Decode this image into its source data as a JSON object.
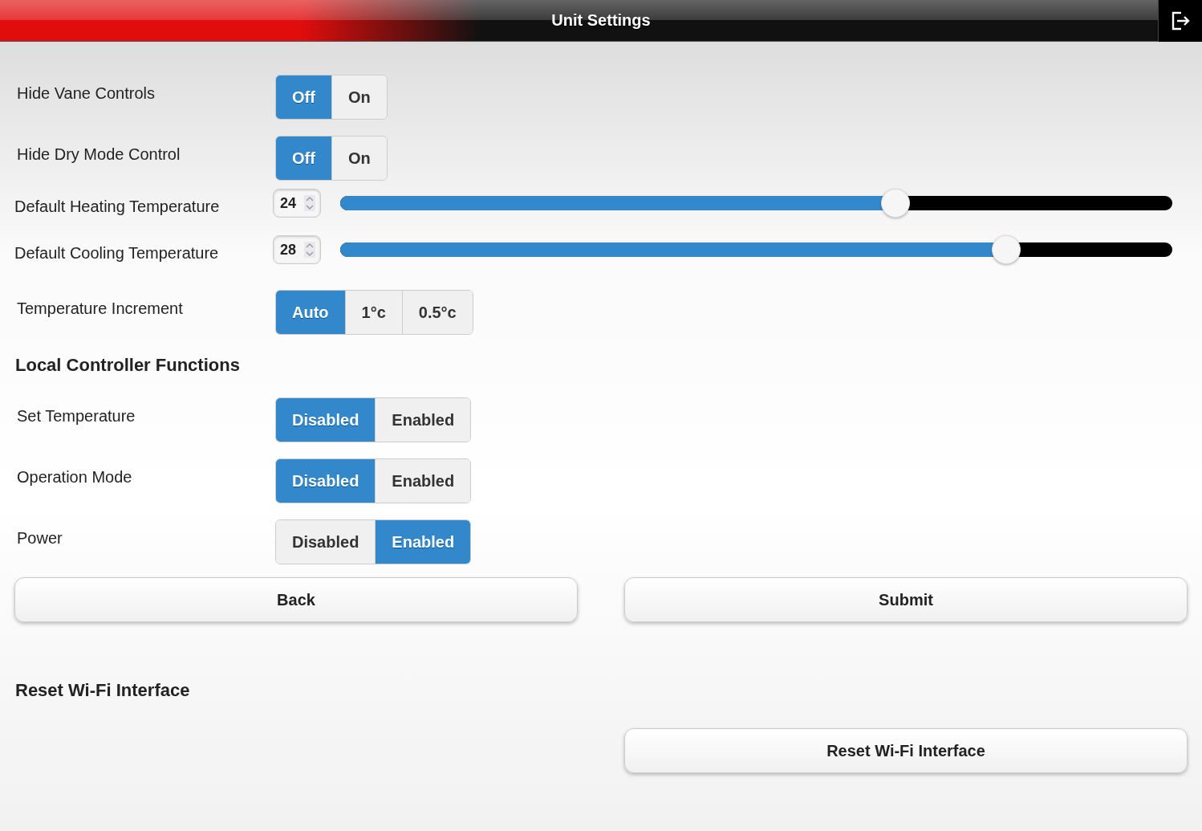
{
  "header": {
    "title": "Unit Settings"
  },
  "settings": [
    {
      "kind": "segmented",
      "label": "Hide Vane Controls",
      "options": [
        {
          "label": "Off",
          "selected": true
        },
        {
          "label": "On",
          "selected": false
        }
      ]
    },
    {
      "kind": "segmented",
      "label": "Hide Dry Mode Control",
      "options": [
        {
          "label": "Off",
          "selected": true
        },
        {
          "label": "On",
          "selected": false
        }
      ]
    },
    {
      "kind": "slider",
      "label": "Default Heating Temperature",
      "value": "24",
      "level": 0.667
    },
    {
      "kind": "slider",
      "label": "Default Cooling Temperature",
      "value": "28",
      "level": 0.8
    },
    {
      "kind": "segmented",
      "label": "Temperature Increment",
      "options": [
        {
          "label": "Auto",
          "selected": true
        },
        {
          "label": "1°c",
          "selected": false
        },
        {
          "label": "0.5°c",
          "selected": false
        }
      ]
    }
  ],
  "local_section": {
    "title": "Local Controller Functions",
    "settings": [
      {
        "kind": "segmented",
        "label": "Set Temperature",
        "options": [
          {
            "label": "Disabled",
            "selected": true
          },
          {
            "label": "Enabled",
            "selected": false
          }
        ]
      },
      {
        "kind": "segmented",
        "label": "Operation Mode",
        "options": [
          {
            "label": "Disabled",
            "selected": true
          },
          {
            "label": "Enabled",
            "selected": false
          }
        ]
      },
      {
        "kind": "segmented",
        "label": "Power",
        "options": [
          {
            "label": "Disabled",
            "selected": false
          },
          {
            "label": "Enabled",
            "selected": true
          }
        ]
      }
    ]
  },
  "buttons": [
    "Back",
    "Submit"
  ],
  "reset_section": {
    "title": "Reset Wi-Fi Interface",
    "button": "Reset Wi-Fi Interface"
  }
}
